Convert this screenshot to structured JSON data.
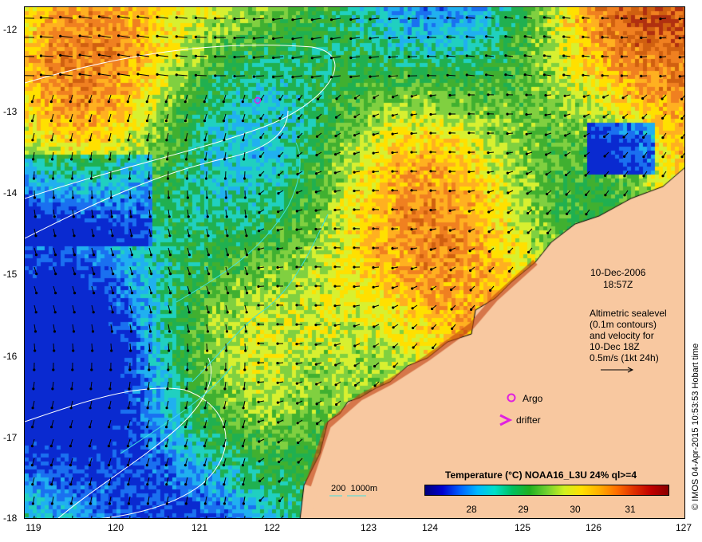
{
  "lat_labels": [
    "-12",
    "-13",
    "-14",
    "-15",
    "-16",
    "-17",
    "-18"
  ],
  "lon_labels": [
    "119",
    "120",
    "121",
    "122",
    "123",
    "124",
    "125",
    "126",
    "127"
  ],
  "datetime": {
    "date": "10-Dec-2006",
    "time": "18:57Z"
  },
  "legend": {
    "line1": "Altimetric sealevel",
    "line2": "(0.1m contours)",
    "line3": "and velocity for",
    "line4": "10-Dec 18Z",
    "scale_label": "0.5m/s (1kt 24h)"
  },
  "markers": {
    "argo_label": "Argo",
    "drifter_label": "drifter",
    "argo_color": "#e020e0",
    "drifter_color": "#e020e0"
  },
  "bathymetry_label": "200  1000m",
  "bathymetry_color": "#40e0e0",
  "colorbar": {
    "title": "Temperature (°C) NOAA16_L3U 24% ql>=4",
    "ticks": [
      "28",
      "29",
      "30",
      "31"
    ]
  },
  "stamp": "© IMOS 04-Apr-2015 10:53:53 Hobart time",
  "colors": {
    "land": "#f8c8a0",
    "ocean_warm": "#e08020",
    "ocean_cool": "#20b040"
  }
}
